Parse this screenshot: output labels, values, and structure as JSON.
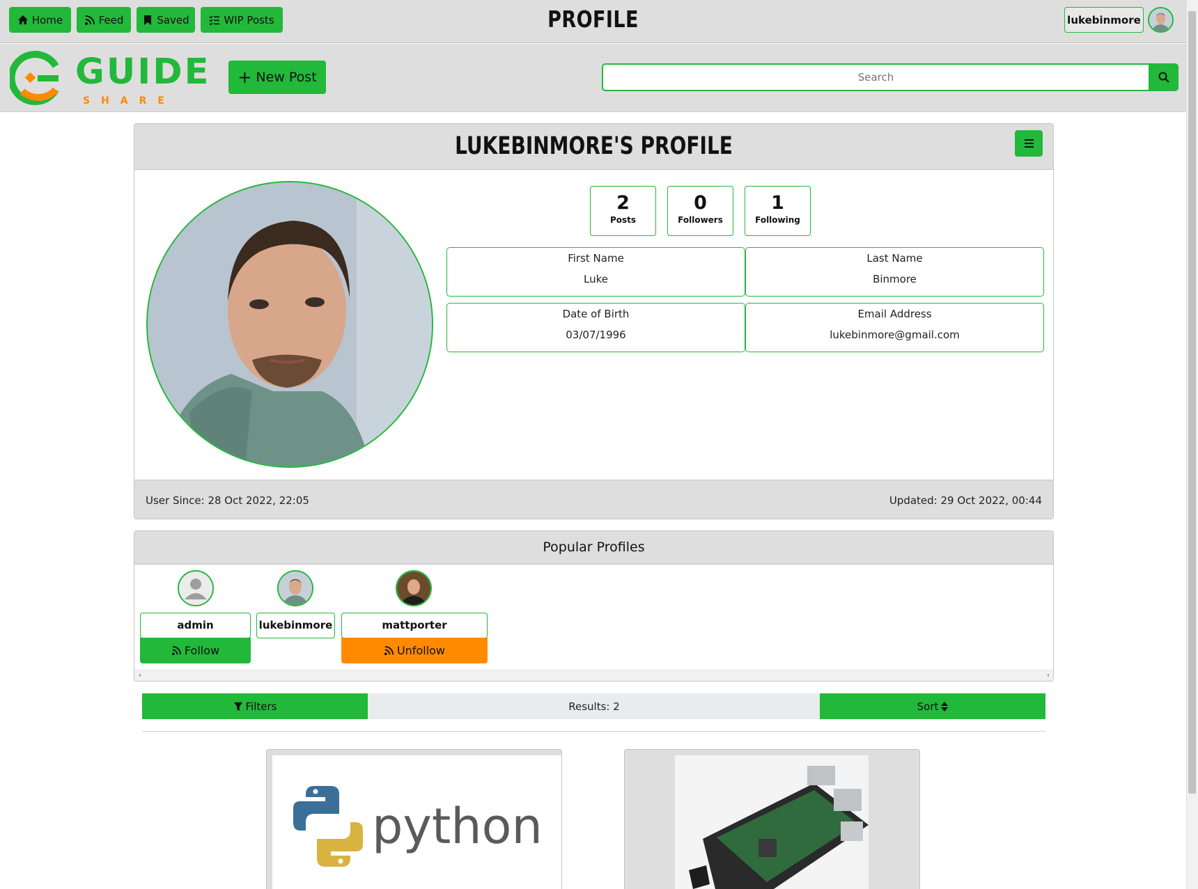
{
  "nav": {
    "home": "Home",
    "feed": "Feed",
    "saved": "Saved",
    "wip": "WIP Posts",
    "title": "PROFILE",
    "username": "lukebinmore"
  },
  "logo": {
    "word": "GUIDE",
    "sub": "S H A R E"
  },
  "toolbar": {
    "new_post": "New Post",
    "search_placeholder": "Search"
  },
  "profile": {
    "title": "LUKEBINMORE'S PROFILE",
    "stats": [
      {
        "value": "2",
        "label": "Posts"
      },
      {
        "value": "0",
        "label": "Followers"
      },
      {
        "value": "1",
        "label": "Following"
      }
    ],
    "fields": [
      {
        "label": "First Name",
        "value": "Luke"
      },
      {
        "label": "Last Name",
        "value": "Binmore"
      },
      {
        "label": "Date of Birth",
        "value": "03/07/1996"
      },
      {
        "label": "Email Address",
        "value": "lukebinmore@gmail.com"
      }
    ],
    "user_since": "User Since: 28 Oct 2022, 22:05",
    "updated": "Updated: 29 Oct 2022, 00:44"
  },
  "popular": {
    "title": "Popular Profiles",
    "profiles": [
      {
        "name": "admin",
        "action": "Follow"
      },
      {
        "name": "lukebinmore",
        "action": ""
      },
      {
        "name": "mattporter",
        "action": "Unfollow"
      }
    ]
  },
  "filterbar": {
    "filters": "Filters",
    "results": "Results: 2",
    "sort": "Sort"
  },
  "posts": [
    {
      "image_text": "python"
    },
    {
      "image_text": ""
    }
  ],
  "colors": {
    "accent": "#22b83a",
    "orange": "#ff8a00",
    "bar": "#dedede"
  }
}
